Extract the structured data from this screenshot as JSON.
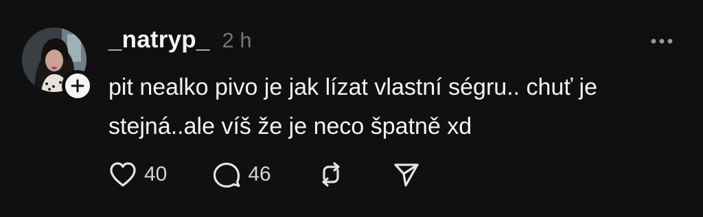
{
  "post": {
    "username": "_natryp_",
    "timestamp": "2 h",
    "text": "pit nealko pivo je jak lízat vlastní ségru.. chuť je stejná..ale víš že je neco špatně xd",
    "actions": {
      "likes": "40",
      "replies": "46"
    }
  },
  "icons": {
    "follow": "plus-icon",
    "more": "more-horizontal-icon",
    "like": "heart-icon",
    "reply": "comment-bubble-icon",
    "repost": "repost-icon",
    "share": "send-icon"
  },
  "colors": {
    "background": "#101010",
    "text": "#f3f5f7",
    "muted": "#777777"
  }
}
